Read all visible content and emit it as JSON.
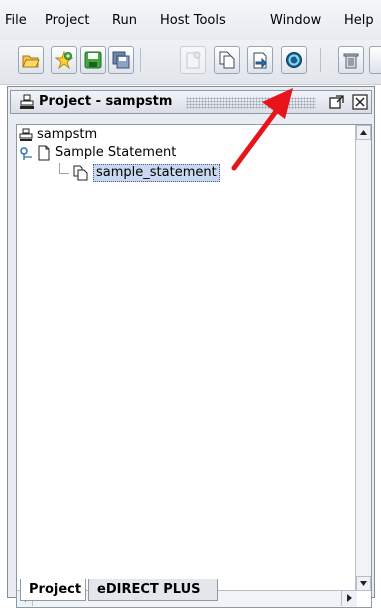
{
  "menubar": {
    "items": [
      "File",
      "Project",
      "Run",
      "Host Tools",
      "Window",
      "Help"
    ]
  },
  "toolbar": {
    "buttons": [
      {
        "name": "open-folder-icon"
      },
      {
        "name": "new-project-star-icon"
      },
      {
        "name": "save-green-icon"
      },
      {
        "name": "save-all-icon"
      },
      {
        "name": "new-document-disabled-icon"
      },
      {
        "name": "copy-document-icon"
      },
      {
        "name": "export-document-icon"
      },
      {
        "name": "refresh-connect-icon"
      },
      {
        "name": "trash-icon"
      }
    ],
    "accent": "#2a6fb0"
  },
  "panel": {
    "title": "Project - sampstm"
  },
  "tree": {
    "root": "sampstm",
    "child": "Sample Statement",
    "leaf": "sample_statement"
  },
  "tabs": [
    "Project",
    "eDIRECT PLUS"
  ],
  "annotation": {
    "arrow_color": "#e8141b"
  }
}
